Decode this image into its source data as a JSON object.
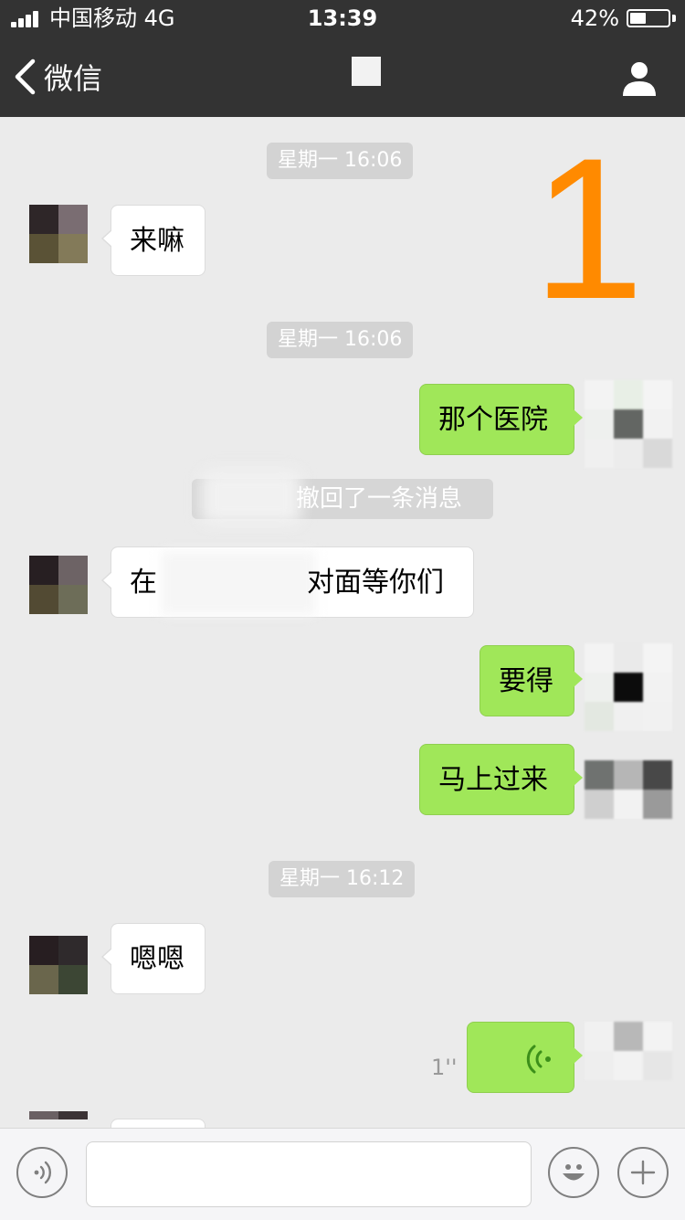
{
  "status_bar": {
    "carrier": "中国移动  4G",
    "time": "13:39",
    "battery": "42%",
    "battery_level": 0.42
  },
  "nav": {
    "back_label": "微信",
    "back_icon": "chevron-left-icon",
    "profile_icon": "person-icon"
  },
  "overlay_number": "1",
  "chat": {
    "timestamps": [
      "星期一 16:06",
      "星期一 16:06",
      "星期一 16:12"
    ],
    "recall_notice": "撤回了一条消息",
    "messages": [
      {
        "side": "left",
        "text": "来嘛"
      },
      {
        "side": "right",
        "text": "那个医院"
      },
      {
        "side": "left",
        "text_start": "在",
        "text_end": "对面等你们"
      },
      {
        "side": "right",
        "text": "要得"
      },
      {
        "side": "right",
        "text": "马上过来"
      },
      {
        "side": "left",
        "text": "嗯嗯"
      },
      {
        "side": "right",
        "type": "voice",
        "duration": "1''"
      }
    ]
  },
  "input_bar": {
    "voice_icon": "voice-input-icon",
    "emoji_icon": "emoji-icon",
    "plus_icon": "plus-icon",
    "placeholder": ""
  },
  "colors": {
    "header_bg": "#333333",
    "chat_bg": "#ebebeb",
    "sent_bubble": "#a0e759",
    "received_bubble": "#ffffff",
    "overlay_orange": "#ff8a00"
  }
}
